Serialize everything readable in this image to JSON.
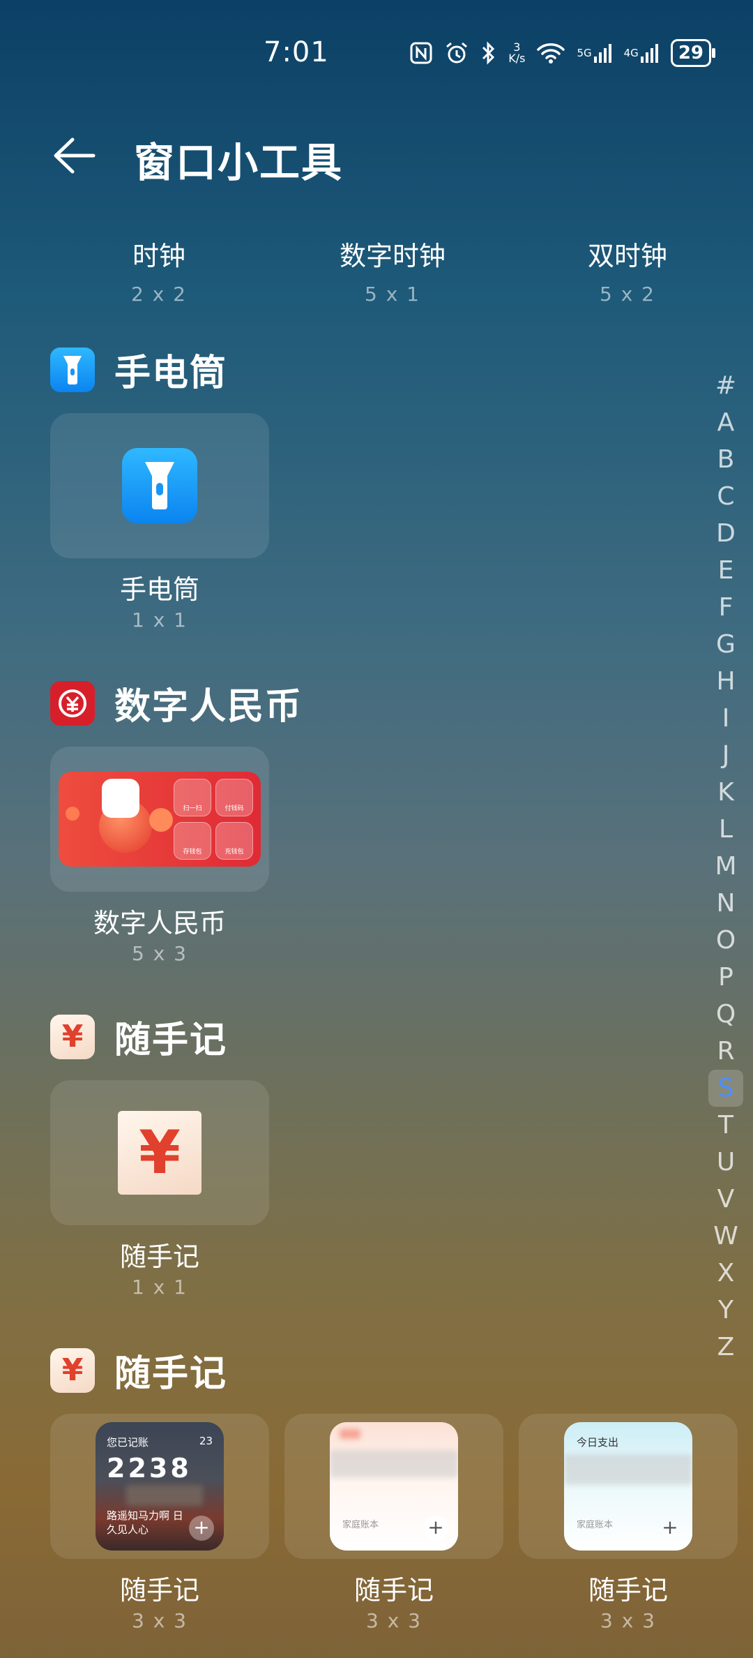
{
  "status_bar": {
    "time": "7:01",
    "net_speed_value": "3",
    "net_speed_unit": "K/s",
    "signal1": "5G",
    "signal2": "4G",
    "battery": "29"
  },
  "header": {
    "title": "窗口小工具"
  },
  "clocks": [
    {
      "name": "时钟",
      "size": "2 x 2"
    },
    {
      "name": "数字时钟",
      "size": "5 x 1"
    },
    {
      "name": "双时钟",
      "size": "5 x 2"
    }
  ],
  "sections": {
    "flashlight": {
      "label": "手电筒",
      "widget_name": "手电筒",
      "widget_size": "1 x 1"
    },
    "rmb": {
      "label": "数字人民币",
      "widget_name": "数字人民币",
      "widget_size": "5 x 3",
      "buttons": [
        "扫一扫",
        "付钱码",
        "存钱包",
        "充钱包"
      ]
    },
    "suishouji1": {
      "label": "随手记",
      "widget_name": "随手记",
      "widget_size": "1 x 1",
      "symbol": "¥"
    },
    "suishouji2": {
      "label": "随手记",
      "widgets": [
        {
          "name": "随手记",
          "size": "3 x 3",
          "line1": "您已记账",
          "days": "23",
          "big": "2238",
          "caption": "路遥知马力啊 日久见人心"
        },
        {
          "name": "随手记",
          "size": "3 x 3",
          "footer": "家庭账本"
        },
        {
          "name": "随手记",
          "size": "3 x 3",
          "header": "今日支出",
          "footer": "家庭账本"
        }
      ]
    }
  },
  "index_letters": [
    "#",
    "A",
    "B",
    "C",
    "D",
    "E",
    "F",
    "G",
    "H",
    "I",
    "J",
    "K",
    "L",
    "M",
    "N",
    "O",
    "P",
    "Q",
    "R",
    "S",
    "T",
    "U",
    "V",
    "W",
    "X",
    "Y",
    "Z"
  ],
  "active_letter": "S"
}
